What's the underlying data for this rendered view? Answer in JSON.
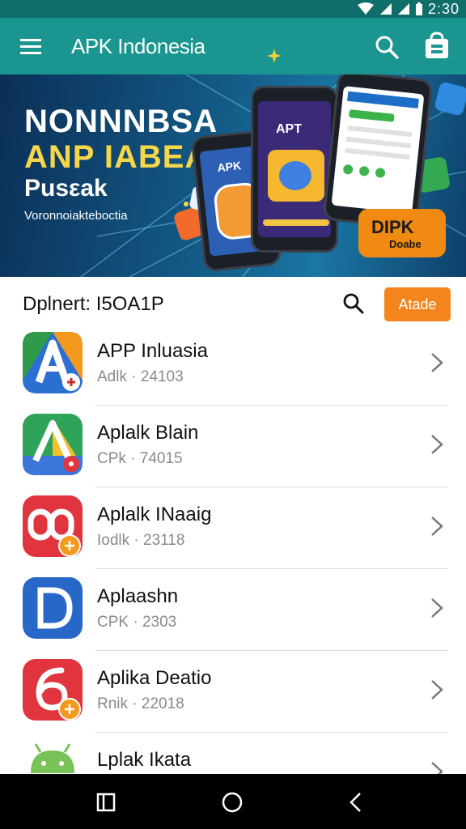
{
  "status_bar": {
    "time": "2:30"
  },
  "app_bar": {
    "title": "APK Indonesia"
  },
  "banner": {
    "line1": "NONNNBSA",
    "line2": "ANP IABEASII",
    "line3": "Pusεak",
    "line4": "Voronnoiakteboctia",
    "phone_label_1": "APK",
    "phone_label_2": "APT",
    "badge_title": "DIPK",
    "badge_sub": "Doabe"
  },
  "filter": {
    "label": "Dplnert: I5OA1P",
    "button_label": "Atade"
  },
  "apps": [
    {
      "name": "APP Inluasia",
      "meta": "Adlk · 24103",
      "icon": "a-logo-icon",
      "colors": [
        "#2f9a4a",
        "#f39a1e",
        "#2b6fd1"
      ]
    },
    {
      "name": "Aplalk Blain",
      "meta": "CPk · 74015",
      "icon": "triangle-logo-icon",
      "colors": [
        "#2fa35a",
        "#f4c02b",
        "#3b76d8"
      ]
    },
    {
      "name": "Aplalk INaaig",
      "meta": "Iodlk · 23118",
      "icon": "infinity-logo-icon",
      "colors": [
        "#e0353f"
      ]
    },
    {
      "name": "Aplaashn",
      "meta": "CPK · 2303",
      "icon": "d-logo-icon",
      "colors": [
        "#2767c8"
      ]
    },
    {
      "name": "Aplika Deatio",
      "meta": "Rnik · 22018",
      "icon": "six-logo-icon",
      "colors": [
        "#e0353f"
      ]
    },
    {
      "name": "Lplak Ikata",
      "meta": "",
      "icon": "android-icon",
      "colors": [
        "#78c257"
      ]
    }
  ]
}
